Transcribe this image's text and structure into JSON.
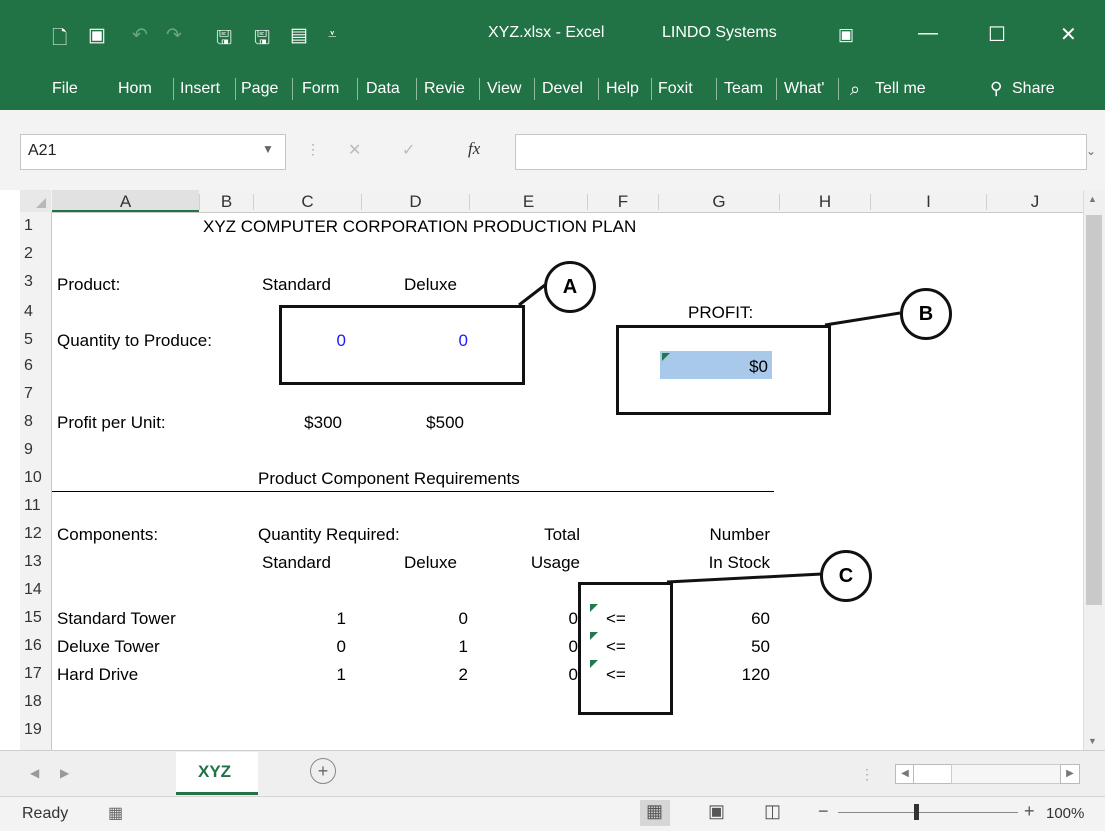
{
  "window": {
    "file_title": "XYZ.xlsx - Excel",
    "account": "LINDO Systems",
    "minimize": "—",
    "maximize": "☐",
    "close": "✕"
  },
  "ribbon": {
    "tabs": [
      "File",
      "Hom",
      "Insert",
      "Page",
      "Form",
      "Data",
      "Revie",
      "View",
      "Devel",
      "Help",
      "Foxit",
      "Team",
      "What'"
    ],
    "tell_me": "Tell me",
    "share": "Share"
  },
  "formula_bar": {
    "name_box": "A21",
    "fx": "fx",
    "formula": ""
  },
  "columns": [
    "A",
    "B",
    "C",
    "D",
    "E",
    "F",
    "G",
    "H",
    "I",
    "J"
  ],
  "rows": [
    "1",
    "2",
    "3",
    "4",
    "5",
    "6",
    "7",
    "8",
    "9",
    "10",
    "11",
    "12",
    "13",
    "14",
    "15",
    "16",
    "17",
    "18",
    "19"
  ],
  "sheet": {
    "title": "XYZ COMPUTER CORPORATION PRODUCTION PLAN",
    "product_label": "Product:",
    "standard": "Standard",
    "deluxe": "Deluxe",
    "qty_label": "Quantity to Produce:",
    "qty_standard": "0",
    "qty_deluxe": "0",
    "profit_label": "PROFIT:",
    "profit_value": "$0",
    "profit_per_unit_label": "Profit per Unit:",
    "profit_standard": "$300",
    "profit_deluxe": "$500",
    "requirements_title": "Product Component Requirements",
    "components_label": "Components:",
    "qty_required": "Quantity Required:",
    "total": "Total",
    "number": "Number",
    "standard2": "Standard",
    "deluxe2": "Deluxe",
    "usage": "Usage",
    "in_stock": "In Stock",
    "components": [
      {
        "name": "Standard Tower",
        "standard": "1",
        "deluxe": "0",
        "usage": "0",
        "op": "<=",
        "stock": "60"
      },
      {
        "name": "Deluxe Tower",
        "standard": "0",
        "deluxe": "1",
        "usage": "0",
        "op": "<=",
        "stock": "50"
      },
      {
        "name": "Hard Drive",
        "standard": "1",
        "deluxe": "2",
        "usage": "0",
        "op": "<=",
        "stock": "120"
      }
    ]
  },
  "callouts": {
    "a": "A",
    "b": "B",
    "c": "C"
  },
  "sheet_tab": "XYZ",
  "status": {
    "ready": "Ready",
    "zoom": "100%"
  }
}
